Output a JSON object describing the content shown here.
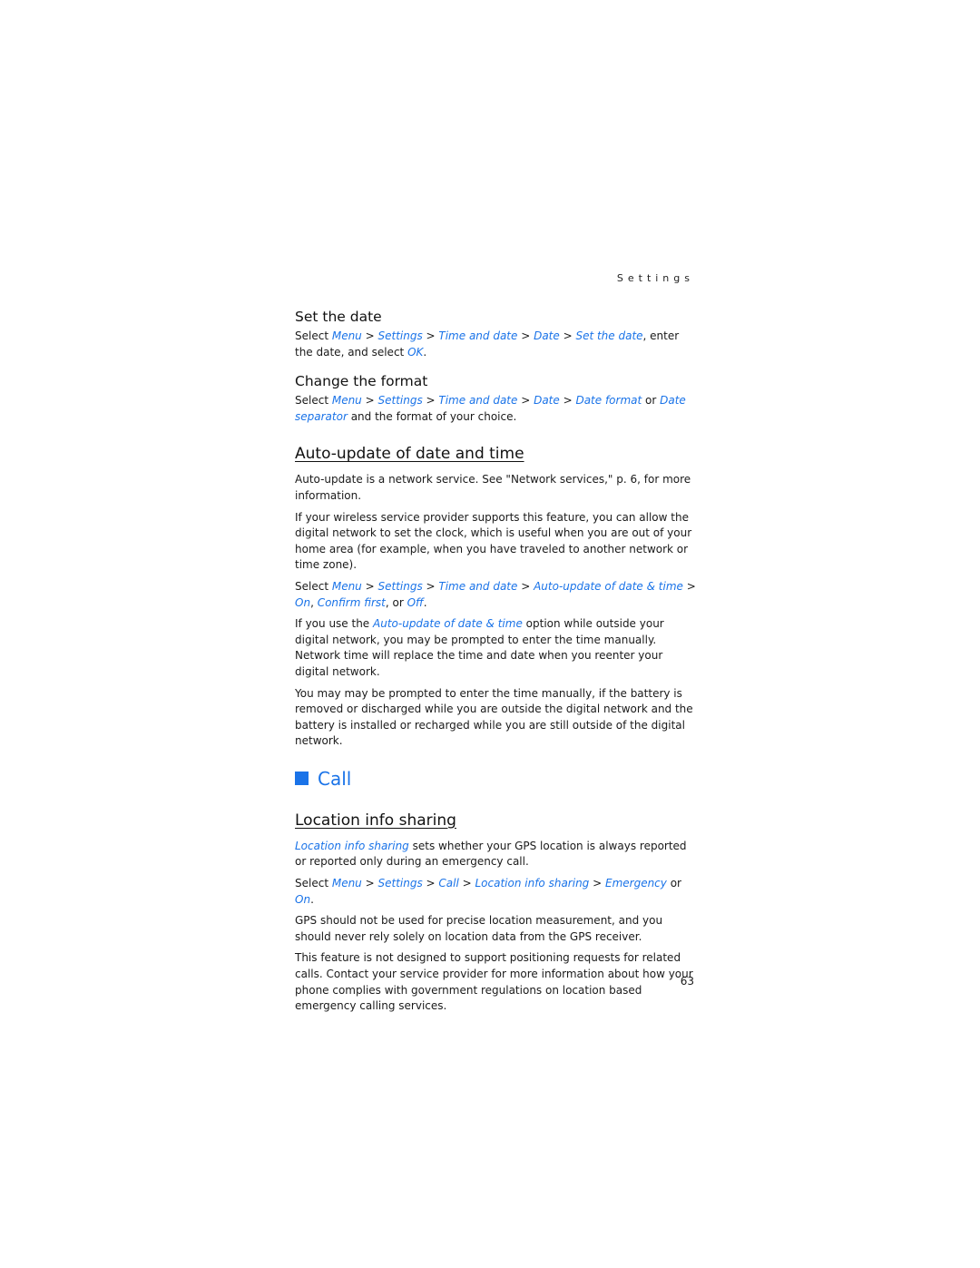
{
  "running_head": "Settings",
  "page_number": "63",
  "colors": {
    "link": "#1a73e8",
    "text": "#1a1a1a"
  },
  "set_date": {
    "heading": "Set the date",
    "p1": {
      "t0": "Select ",
      "l1": "Menu",
      "s1": " > ",
      "l2": "Settings",
      "s2": " > ",
      "l3": "Time and date",
      "s3": " > ",
      "l4": "Date",
      "s4": " > ",
      "l5": "Set the date",
      "t1": ", enter the date, and select ",
      "l6": "OK",
      "t2": "."
    }
  },
  "change_format": {
    "heading": "Change the format",
    "p1": {
      "t0": "Select ",
      "l1": "Menu",
      "s1": " > ",
      "l2": "Settings",
      "s2": " > ",
      "l3": "Time and date",
      "s3": " > ",
      "l4": "Date",
      "s4": " > ",
      "l5": "Date format",
      "t1": " or ",
      "l6": "Date separator",
      "t2": " and the format of your choice."
    }
  },
  "auto_update": {
    "heading": "Auto-update of date and time",
    "p1": "Auto-update is a network service. See \"Network services,\" p. 6, for more information.",
    "p2": "If your wireless service provider supports this feature, you can allow the digital network to set the clock, which is useful when you are out of your home area (for example, when you have traveled to another network or time zone).",
    "p3": {
      "t0": "Select ",
      "l1": "Menu",
      "s1": " > ",
      "l2": "Settings",
      "s2": " > ",
      "l3": "Time and date",
      "s3": " > ",
      "l4": "Auto-update of date & time",
      "s4": " > ",
      "l5": "On",
      "t1": ", ",
      "l6": "Confirm first",
      "t2": ", or ",
      "l7": "Off",
      "t3": "."
    },
    "p4": {
      "t0": "If you use the ",
      "l1": "Auto-update of date & time",
      "t1": " option while outside your digital network, you may be prompted to enter the time manually. Network time will replace the time and date when you reenter your digital network."
    },
    "p5": "You may may be prompted to enter the time manually, if the battery is removed or discharged while you are outside the digital network and the battery is installed or recharged while you are still outside of the digital network."
  },
  "call": {
    "heading": "Call",
    "icon": "square-bullet-icon"
  },
  "location": {
    "heading": "Location info sharing",
    "p1": {
      "l1": "Location info sharing",
      "t1": " sets whether your GPS location is always reported or reported only during an emergency call."
    },
    "p2": {
      "t0": "Select ",
      "l1": "Menu",
      "s1": " > ",
      "l2": "Settings",
      "s2": " > ",
      "l3": "Call",
      "s3": " > ",
      "l4": "Location info sharing",
      "s4": " > ",
      "l5": "Emergency",
      "t1": " or ",
      "l6": "On",
      "t2": "."
    },
    "p3": "GPS should not be used for precise location measurement, and you should never rely solely on location data from the GPS receiver.",
    "p4": "This feature is not designed to support positioning requests for related calls. Contact your service provider for more information about how your phone complies with government regulations on location based emergency calling services."
  }
}
